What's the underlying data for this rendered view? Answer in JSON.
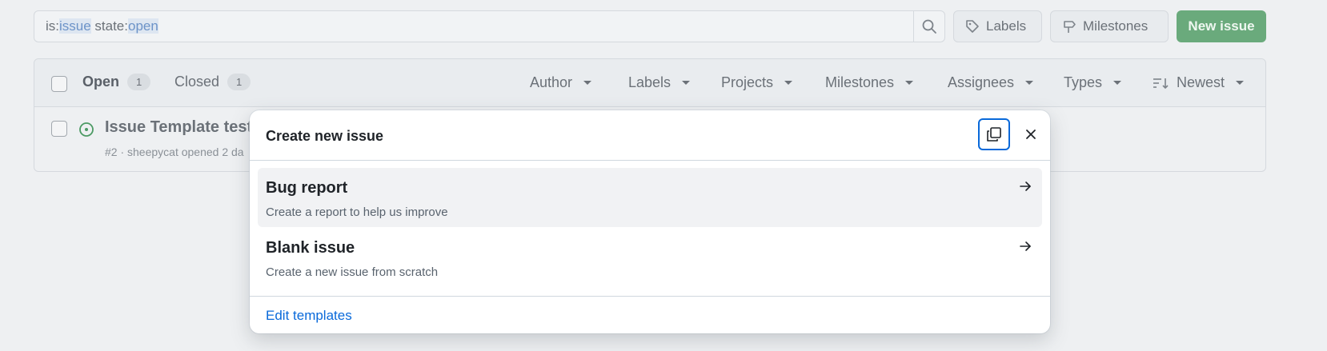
{
  "search": {
    "prefix1": "is:",
    "value1": "issue",
    "prefix2": " state:",
    "value2": "open"
  },
  "toolbar": {
    "labels_label": "Labels",
    "milestones_label": "Milestones",
    "new_issue_label": "New issue"
  },
  "issues": {
    "open_label": "Open",
    "open_count": "1",
    "closed_label": "Closed",
    "closed_count": "1",
    "filters": [
      "Author",
      "Labels",
      "Projects",
      "Milestones",
      "Assignees",
      "Types",
      "Newest"
    ],
    "rows": [
      {
        "title": "Issue Template test",
        "meta": "#2 · sheepycat opened 2 da"
      }
    ]
  },
  "dialog": {
    "title": "Create new issue",
    "options": [
      {
        "title": "Bug report",
        "description": "Create a report to help us improve"
      },
      {
        "title": "Blank issue",
        "description": "Create a new issue from scratch"
      }
    ],
    "footer_link": "Edit templates"
  },
  "colors": {
    "accent": "#0969da",
    "primary_button": "#6aaa7c",
    "open_icon": "#4c9a64"
  }
}
